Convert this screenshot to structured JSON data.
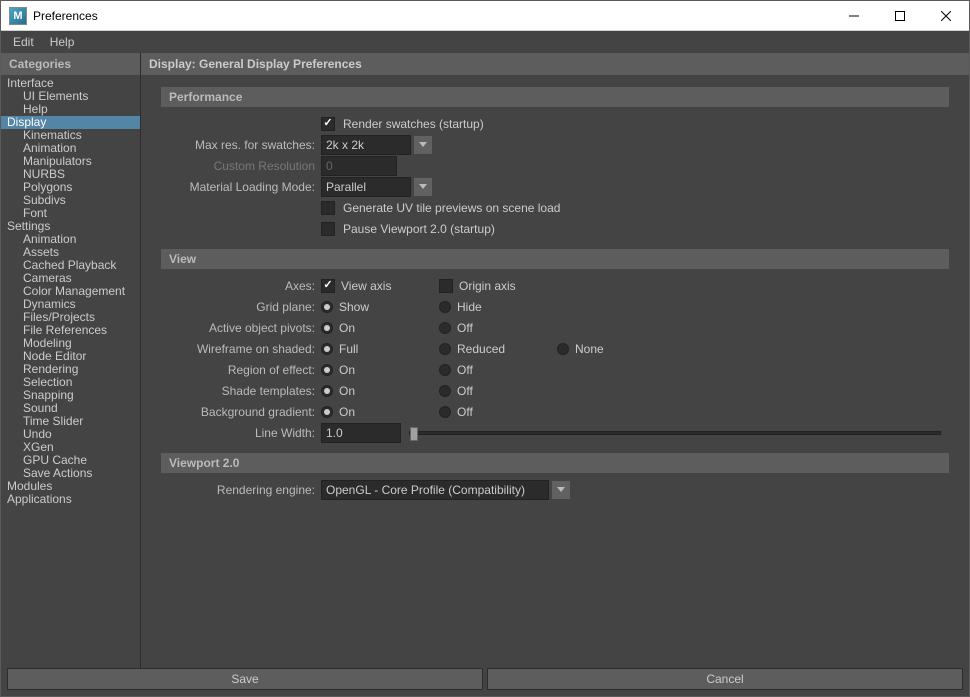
{
  "window": {
    "title": "Preferences"
  },
  "menubar": {
    "edit": "Edit",
    "help": "Help"
  },
  "sidebar": {
    "header": "Categories",
    "items": [
      {
        "label": "Interface",
        "level": 0
      },
      {
        "label": "UI Elements",
        "level": 1
      },
      {
        "label": "Help",
        "level": 1
      },
      {
        "label": "Display",
        "level": 0,
        "selected": true
      },
      {
        "label": "Kinematics",
        "level": 1
      },
      {
        "label": "Animation",
        "level": 1
      },
      {
        "label": "Manipulators",
        "level": 1
      },
      {
        "label": "NURBS",
        "level": 1
      },
      {
        "label": "Polygons",
        "level": 1
      },
      {
        "label": "Subdivs",
        "level": 1
      },
      {
        "label": "Font",
        "level": 1
      },
      {
        "label": "Settings",
        "level": 0
      },
      {
        "label": "Animation",
        "level": 1
      },
      {
        "label": "Assets",
        "level": 1
      },
      {
        "label": "Cached Playback",
        "level": 1
      },
      {
        "label": "Cameras",
        "level": 1
      },
      {
        "label": "Color Management",
        "level": 1
      },
      {
        "label": "Dynamics",
        "level": 1
      },
      {
        "label": "Files/Projects",
        "level": 1
      },
      {
        "label": "File References",
        "level": 1
      },
      {
        "label": "Modeling",
        "level": 1
      },
      {
        "label": "Node Editor",
        "level": 1
      },
      {
        "label": "Rendering",
        "level": 1
      },
      {
        "label": "Selection",
        "level": 1
      },
      {
        "label": "Snapping",
        "level": 1
      },
      {
        "label": "Sound",
        "level": 1
      },
      {
        "label": "Time Slider",
        "level": 1
      },
      {
        "label": "Undo",
        "level": 1
      },
      {
        "label": "XGen",
        "level": 1
      },
      {
        "label": "GPU Cache",
        "level": 1
      },
      {
        "label": "Save Actions",
        "level": 1
      },
      {
        "label": "Modules",
        "level": 0
      },
      {
        "label": "Applications",
        "level": 0
      }
    ]
  },
  "content": {
    "header": "Display: General Display Preferences",
    "performance": {
      "title": "Performance",
      "render_swatches": {
        "label": "Render swatches (startup)",
        "checked": true
      },
      "max_res": {
        "label": "Max res. for swatches:",
        "value": "2k x 2k"
      },
      "custom_res": {
        "label": "Custom Resolution",
        "value": "0"
      },
      "mat_load": {
        "label": "Material Loading Mode:",
        "value": "Parallel"
      },
      "gen_uv": {
        "label": "Generate UV tile previews on scene load",
        "checked": false
      },
      "pause_vp": {
        "label": "Pause Viewport 2.0 (startup)",
        "checked": false
      }
    },
    "view": {
      "title": "View",
      "axes": {
        "label": "Axes:",
        "view_axis": "View axis",
        "view_checked": true,
        "origin_axis": "Origin axis",
        "origin_checked": false
      },
      "grid_plane": {
        "label": "Grid plane:",
        "options": [
          "Show",
          "Hide"
        ],
        "selected": 0
      },
      "active_pivots": {
        "label": "Active object pivots:",
        "options": [
          "On",
          "Off"
        ],
        "selected": 0
      },
      "wireframe": {
        "label": "Wireframe on shaded:",
        "options": [
          "Full",
          "Reduced",
          "None"
        ],
        "selected": 0
      },
      "region": {
        "label": "Region of effect:",
        "options": [
          "On",
          "Off"
        ],
        "selected": 0
      },
      "shade_templates": {
        "label": "Shade templates:",
        "options": [
          "On",
          "Off"
        ],
        "selected": 0
      },
      "bg_gradient": {
        "label": "Background gradient:",
        "options": [
          "On",
          "Off"
        ],
        "selected": 0
      },
      "line_width": {
        "label": "Line Width:",
        "value": "1.0"
      }
    },
    "viewport2": {
      "title": "Viewport 2.0",
      "rendering_engine": {
        "label": "Rendering engine:",
        "value": "OpenGL - Core Profile (Compatibility)"
      }
    }
  },
  "footer": {
    "save": "Save",
    "cancel": "Cancel"
  }
}
